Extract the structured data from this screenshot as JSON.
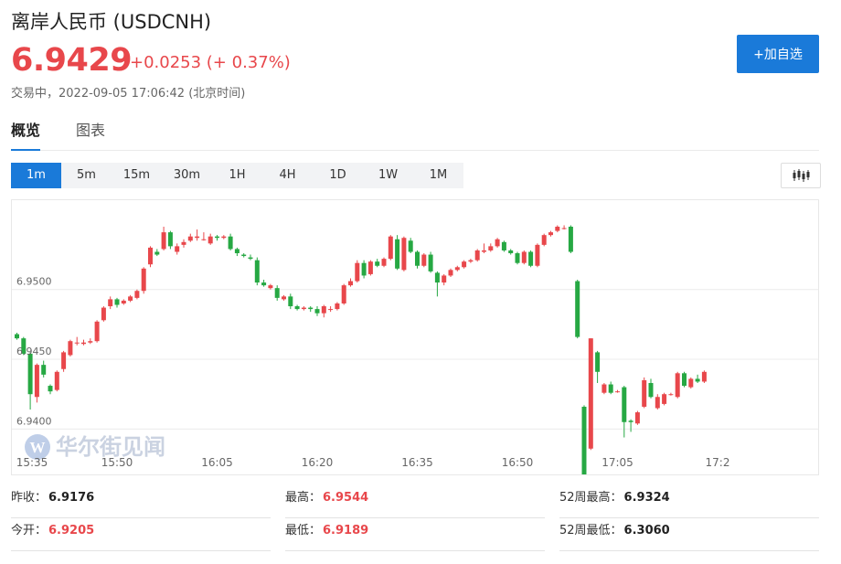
{
  "header": {
    "title": "离岸人民币 (USDCNH)",
    "price": "6.9429",
    "change": "+0.0253 (+ 0.37%)",
    "status": "交易中，2022-09-05 17:06:42 (北京时间)",
    "add_button": "+加自选",
    "colors": {
      "up": "#e8474b",
      "down": "#26a843",
      "accent": "#1a7ad9"
    }
  },
  "tabs": [
    {
      "label": "概览",
      "active": true
    },
    {
      "label": "图表",
      "active": false
    }
  ],
  "periods": [
    {
      "label": "1m",
      "active": true
    },
    {
      "label": "5m",
      "active": false
    },
    {
      "label": "15m",
      "active": false
    },
    {
      "label": "30m",
      "active": false
    },
    {
      "label": "1H",
      "active": false
    },
    {
      "label": "4H",
      "active": false
    },
    {
      "label": "1D",
      "active": false
    },
    {
      "label": "1W",
      "active": false
    },
    {
      "label": "1M",
      "active": false
    }
  ],
  "chart_type_icon": "candlestick-icon",
  "watermark": "华尔街见闻",
  "chart_data": {
    "type": "candlestick",
    "y_ticks": [
      "6.9500",
      "6.9450",
      "6.9400"
    ],
    "y_tick_values": [
      6.95,
      6.945,
      6.94
    ],
    "ylim": [
      6.93675,
      6.9564
    ],
    "x_ticks": [
      "15:35",
      "15:50",
      "16:05",
      "16:20",
      "16:35",
      "16:50",
      "17:05",
      "17:2"
    ],
    "grid": true,
    "up_color": "#e8474b",
    "down_color": "#26a843",
    "candles": [
      [
        6.9468,
        6.9465,
        6.9469,
        6.9464
      ],
      [
        6.9465,
        6.9454,
        6.9466,
        6.9453
      ],
      [
        6.9454,
        6.9425,
        6.9455,
        6.9414
      ],
      [
        6.9423,
        6.9446,
        6.9447,
        6.9419
      ],
      [
        6.9446,
        6.9439,
        6.9449,
        6.9437
      ],
      [
        6.9431,
        6.9427,
        6.9432,
        6.9425
      ],
      [
        6.9428,
        6.9441,
        6.9442,
        6.9427
      ],
      [
        6.9443,
        6.9455,
        6.9456,
        6.9441
      ],
      [
        6.9453,
        6.9463,
        6.9464,
        6.9452
      ],
      [
        6.9462,
        6.9462,
        6.9466,
        6.946
      ],
      [
        6.9461,
        6.9462,
        6.9464,
        6.946
      ],
      [
        6.9462,
        6.9463,
        6.9465,
        6.9461
      ],
      [
        6.9463,
        6.9477,
        6.9478,
        6.9462
      ],
      [
        6.9478,
        6.9487,
        6.9488,
        6.9477
      ],
      [
        6.9488,
        6.9493,
        6.9495,
        6.9486
      ],
      [
        6.9493,
        6.9489,
        6.9494,
        6.9487
      ],
      [
        6.949,
        6.9492,
        6.9493,
        6.9489
      ],
      [
        6.9492,
        6.9495,
        6.9496,
        6.9491
      ],
      [
        6.9494,
        6.9499,
        6.95,
        6.9493
      ],
      [
        6.9499,
        6.9515,
        6.9516,
        6.9497
      ],
      [
        6.9518,
        6.953,
        6.9531,
        6.9516
      ],
      [
        6.9527,
        6.9525,
        6.9529,
        6.9524
      ],
      [
        6.9529,
        6.9541,
        6.9545,
        6.9528
      ],
      [
        6.9541,
        6.9531,
        6.9542,
        6.9529
      ],
      [
        6.9527,
        6.9531,
        6.9533,
        6.9525
      ],
      [
        6.9532,
        6.9534,
        6.9536,
        6.953
      ],
      [
        6.9535,
        6.9538,
        6.954,
        6.9534
      ],
      [
        6.9537,
        6.9538,
        6.9543,
        6.9535
      ],
      [
        6.9536,
        6.9536,
        6.9541,
        6.9535
      ],
      [
        6.9533,
        6.9538,
        6.954,
        6.9532
      ],
      [
        6.9538,
        6.9537,
        6.9539,
        6.9535
      ],
      [
        6.9537,
        6.9538,
        6.9539,
        6.9536
      ],
      [
        6.9538,
        6.9529,
        6.954,
        6.9528
      ],
      [
        6.9529,
        6.9526,
        6.953,
        6.9524
      ],
      [
        6.9525,
        6.9524,
        6.9526,
        6.9523
      ],
      [
        6.9523,
        6.9522,
        6.9525,
        6.9521
      ],
      [
        6.9521,
        6.9505,
        6.9523,
        6.9503
      ],
      [
        6.9505,
        6.9503,
        6.9507,
        6.9502
      ],
      [
        6.9501,
        6.9503,
        6.9504,
        6.95
      ],
      [
        6.9501,
        6.9494,
        6.9503,
        6.9492
      ],
      [
        6.9493,
        6.9495,
        6.9496,
        6.9492
      ],
      [
        6.9495,
        6.9488,
        6.9497,
        6.9486
      ],
      [
        6.9488,
        6.9486,
        6.9489,
        6.9485
      ],
      [
        6.9486,
        6.9487,
        6.9488,
        6.9485
      ],
      [
        6.9487,
        6.9486,
        6.9488,
        6.9484
      ],
      [
        6.9486,
        6.9483,
        6.9488,
        6.9481
      ],
      [
        6.9483,
        6.9488,
        6.9489,
        6.948
      ],
      [
        6.9486,
        6.9486,
        6.9488,
        6.9484
      ],
      [
        6.9486,
        6.949,
        6.9491,
        6.9485
      ],
      [
        6.949,
        6.9503,
        6.9504,
        6.9489
      ],
      [
        6.9503,
        6.9506,
        6.9508,
        6.9502
      ],
      [
        6.9506,
        6.9519,
        6.9521,
        6.9505
      ],
      [
        6.9519,
        6.951,
        6.9521,
        6.9508
      ],
      [
        6.9511,
        6.952,
        6.9521,
        6.951
      ],
      [
        6.952,
        6.9517,
        6.9522,
        6.9516
      ],
      [
        6.9517,
        6.9522,
        6.9523,
        6.9516
      ],
      [
        6.9522,
        6.9538,
        6.9539,
        6.9521
      ],
      [
        6.9536,
        6.9515,
        6.9539,
        6.9514
      ],
      [
        6.9514,
        6.9537,
        6.9538,
        6.9513
      ],
      [
        6.9535,
        6.9527,
        6.9537,
        6.9526
      ],
      [
        6.9527,
        6.9517,
        6.9528,
        6.9515
      ],
      [
        6.9517,
        6.9525,
        6.9526,
        6.9516
      ],
      [
        6.9525,
        6.9513,
        6.9527,
        6.9512
      ],
      [
        6.9512,
        6.9505,
        6.9513,
        6.9495
      ],
      [
        6.9505,
        6.951,
        6.9511,
        6.9503
      ],
      [
        6.951,
        6.9514,
        6.9515,
        6.9509
      ],
      [
        6.9514,
        6.9516,
        6.9517,
        6.9513
      ],
      [
        6.9516,
        6.952,
        6.9521,
        6.9515
      ],
      [
        6.952,
        6.9521,
        6.9522,
        6.9519
      ],
      [
        6.9521,
        6.9528,
        6.9529,
        6.952
      ],
      [
        6.9527,
        6.9528,
        6.9533,
        6.9526
      ],
      [
        6.9528,
        6.9531,
        6.9533,
        6.9527
      ],
      [
        6.9531,
        6.9536,
        6.9537,
        6.953
      ],
      [
        6.9534,
        6.9528,
        6.9535,
        6.9527
      ],
      [
        6.9528,
        6.9526,
        6.9529,
        6.9525
      ],
      [
        6.9526,
        6.9519,
        6.9527,
        6.9518
      ],
      [
        6.9519,
        6.9527,
        6.9528,
        6.9518
      ],
      [
        6.9527,
        6.9517,
        6.9528,
        6.9516
      ],
      [
        6.9517,
        6.9532,
        6.9533,
        6.9516
      ],
      [
        6.9532,
        6.9539,
        6.954,
        6.9531
      ],
      [
        6.9539,
        6.9541,
        6.9542,
        6.9538
      ],
      [
        6.9542,
        6.9545,
        6.9546,
        6.9541
      ],
      [
        6.9544,
        6.9544,
        6.9546,
        6.9543
      ],
      [
        6.9545,
        6.9527,
        6.9546,
        6.9526
      ],
      [
        6.9506,
        6.9466,
        6.9507,
        6.9465
      ],
      [
        6.9416,
        6.9343,
        6.9417,
        6.934
      ],
      [
        6.9386,
        6.9465,
        6.9465,
        6.9385
      ],
      [
        6.9455,
        6.9441,
        6.9456,
        6.9433
      ],
      [
        6.9426,
        6.9432,
        6.9433,
        6.9425
      ],
      [
        6.9432,
        6.9426,
        6.9434,
        6.9425
      ],
      [
        6.9427,
        6.9427,
        6.9428,
        6.9426
      ],
      [
        6.943,
        6.9405,
        6.9431,
        6.9394
      ],
      [
        6.9406,
        6.9405,
        6.9407,
        6.9398
      ],
      [
        6.9404,
        6.9412,
        6.9413,
        6.9403
      ],
      [
        6.9416,
        6.9435,
        6.9437,
        6.9415
      ],
      [
        6.9433,
        6.9423,
        6.9436,
        6.9422
      ],
      [
        6.9415,
        6.9423,
        6.9425,
        6.9414
      ],
      [
        6.9418,
        6.9425,
        6.9426,
        6.9417
      ],
      [
        6.9425,
        6.9425,
        6.9426,
        6.9424
      ],
      [
        6.9423,
        6.944,
        6.9441,
        6.9422
      ],
      [
        6.944,
        6.9431,
        6.9441,
        6.943
      ],
      [
        6.943,
        6.9436,
        6.9437,
        6.9429
      ],
      [
        6.9436,
        6.9434,
        6.9439,
        6.9433
      ],
      [
        6.9434,
        6.9441,
        6.9442,
        6.9433
      ]
    ]
  },
  "stats": {
    "prev_close_label": "昨收：",
    "prev_close": "6.9176",
    "high_label": "最高：",
    "high": "6.9544",
    "high52_label": "52周最高：",
    "high52": "6.9324",
    "open_label": "今开：",
    "open": "6.9205",
    "low_label": "最低：",
    "low": "6.9189",
    "low52_label": "52周最低：",
    "low52": "6.3060"
  }
}
